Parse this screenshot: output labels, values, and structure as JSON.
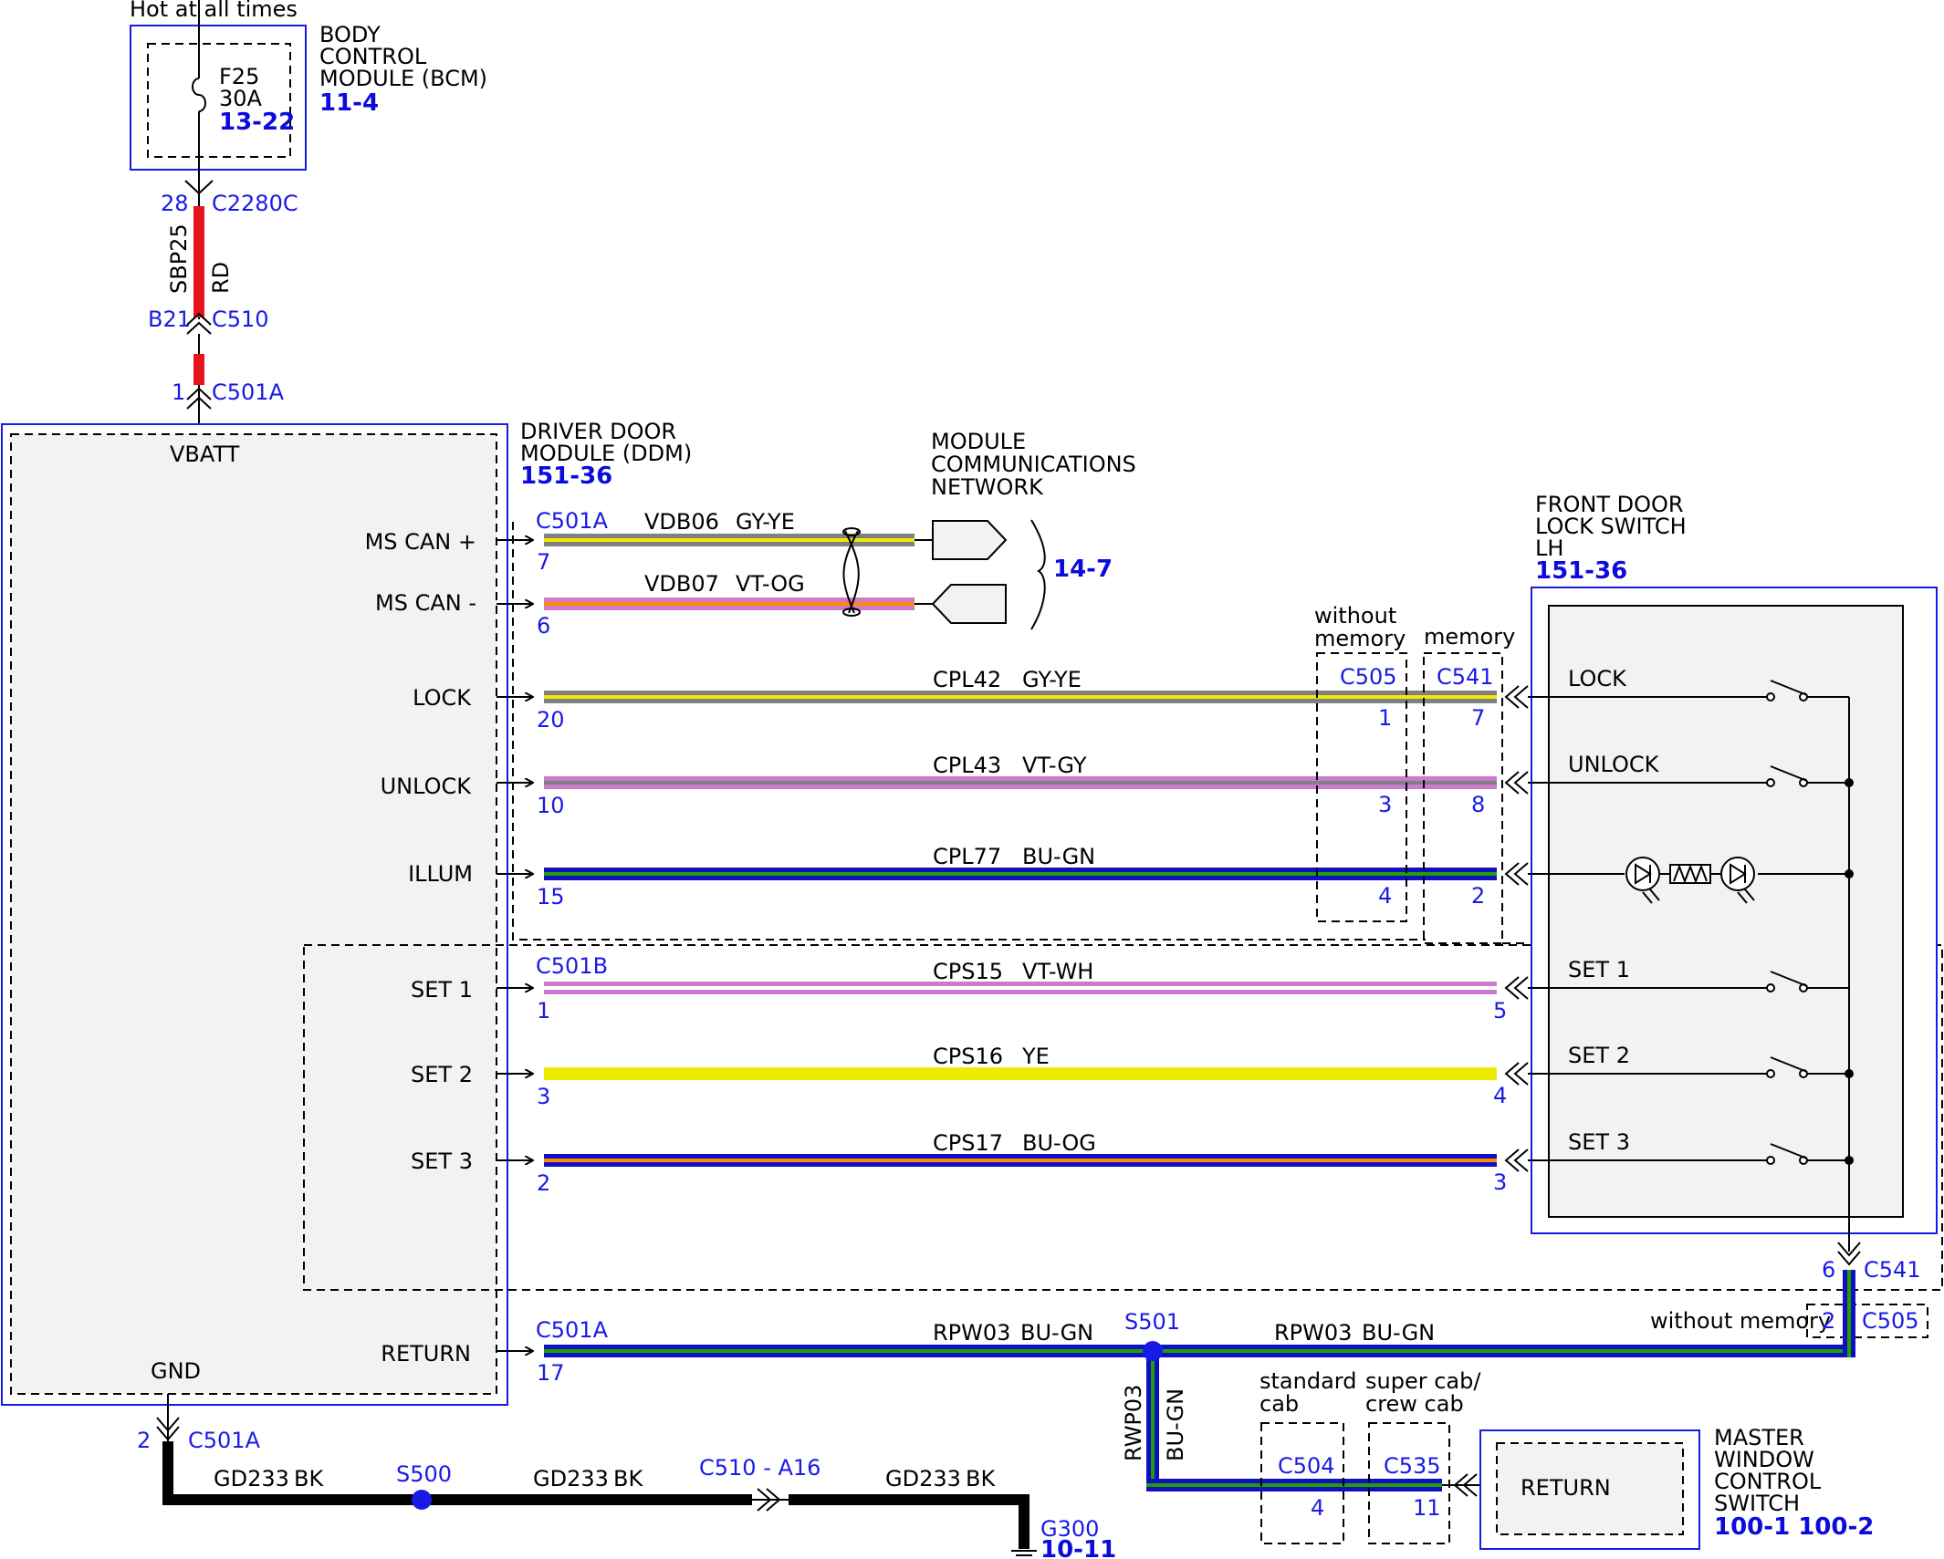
{
  "colors": {
    "accent": "#1a1ae6",
    "module_outline": "#1a1ae6",
    "module_fill": "#f2f2f2",
    "RD": "#e8141c",
    "GY": "#808080",
    "YE": "#f0ea00",
    "VT": "#cc7acc",
    "OG": "#ff8c00",
    "BU": "#1010c0",
    "GN": "#1fa000",
    "WH": "#ffffff",
    "BK": "#000000"
  },
  "top": {
    "hot_label": "Hot at all times",
    "fuse_name": "F25",
    "fuse_amps": "30A",
    "fuse_ref": "13-22",
    "bcm_line1": "BODY",
    "bcm_line2": "CONTROL",
    "bcm_line3": "MODULE (BCM)",
    "bcm_ref": "11-4",
    "c2280c_pin": "28",
    "c2280c": "C2280C",
    "feed_circuit": "SBP25",
    "feed_color": "RD",
    "c510_pin": "B21",
    "c510": "C510",
    "c501a_pin": "1",
    "c501a": "C501A"
  },
  "ddm": {
    "title1": "DRIVER DOOR",
    "title2": "MODULE (DDM)",
    "ref": "151-36",
    "vbatt": "VBATT",
    "gnd": "GND",
    "pins": {
      "ms_can_plus": "MS CAN +",
      "ms_can_minus": "MS CAN -",
      "lock": "LOCK",
      "unlock": "UNLOCK",
      "illum": "ILLUM",
      "set1": "SET 1",
      "set2": "SET 2",
      "set3": "SET 3",
      "return": "RETURN"
    },
    "conn_a_top": "C501A",
    "conn_b": "C501B",
    "conn_a_return": "C501A"
  },
  "mcn": {
    "line1": "MODULE",
    "line2": "COMMUNICATIONS",
    "line3": "NETWORK",
    "ref": "14-7"
  },
  "wires": [
    {
      "key": "can_plus",
      "pin": "7",
      "circuit": "VDB06",
      "color": "GY-YE"
    },
    {
      "key": "can_minus",
      "pin": "6",
      "circuit": "VDB07",
      "color": "VT-OG"
    },
    {
      "key": "lock",
      "pin": "20",
      "circuit": "CPL42",
      "color": "GY-YE",
      "c505_pin": "1",
      "c541_pin": "7"
    },
    {
      "key": "unlock",
      "pin": "10",
      "circuit": "CPL43",
      "color": "VT-GY",
      "c505_pin": "3",
      "c541_pin": "8"
    },
    {
      "key": "illum",
      "pin": "15",
      "circuit": "CPL77",
      "color": "BU-GN",
      "c505_pin": "4",
      "c541_pin": "2"
    },
    {
      "key": "set1",
      "pin": "1",
      "circuit": "CPS15",
      "color": "VT-WH",
      "c541_pin": "5"
    },
    {
      "key": "set2",
      "pin": "3",
      "circuit": "CPS16",
      "color": "YE",
      "c541_pin": "4"
    },
    {
      "key": "set3",
      "pin": "2",
      "circuit": "CPS17",
      "color": "BU-OG",
      "c541_pin": "3"
    }
  ],
  "options": {
    "without_memory_1": "without",
    "without_memory_2": "memory",
    "memory": "memory",
    "c505": "C505",
    "c541": "C541"
  },
  "lock_switch": {
    "title1": "FRONT DOOR",
    "title2": "LOCK SWITCH",
    "title3": "LH",
    "ref": "151-36",
    "lock": "LOCK",
    "unlock": "UNLOCK",
    "set1": "SET 1",
    "set2": "SET 2",
    "set3": "SET 3",
    "out_pin": "6",
    "out_conn": "C541",
    "without_memory": "without memory",
    "c505_pin": "2",
    "c505": "C505"
  },
  "return_circuit": {
    "ddm_pin": "17",
    "circuit": "RPW03",
    "color": "BU-GN",
    "splice": "S501",
    "circuit_right": "RPW03",
    "color_right": "BU-GN",
    "vert_circuit": "RWP03",
    "vert_color": "BU-GN",
    "standard_cab_1": "standard",
    "standard_cab_2": "cab",
    "super_cab_1": "super cab/",
    "super_cab_2": "crew cab",
    "c504": "C504",
    "c504_pin": "4",
    "c535": "C535",
    "c535_pin": "11"
  },
  "master_switch": {
    "return": "RETURN",
    "title1": "MASTER",
    "title2": "WINDOW",
    "title3": "CONTROL",
    "title4": "SWITCH",
    "ref": "100-1 100-2"
  },
  "ground": {
    "pin": "2",
    "conn": "C501A",
    "circuit1": "GD233",
    "color1": "BK",
    "splice": "S500",
    "circuit2": "GD233",
    "color2": "BK",
    "inline_conn": "C510 - A16",
    "circuit3": "GD233",
    "color3": "BK",
    "ground_name": "G300",
    "ground_ref": "10-11"
  }
}
